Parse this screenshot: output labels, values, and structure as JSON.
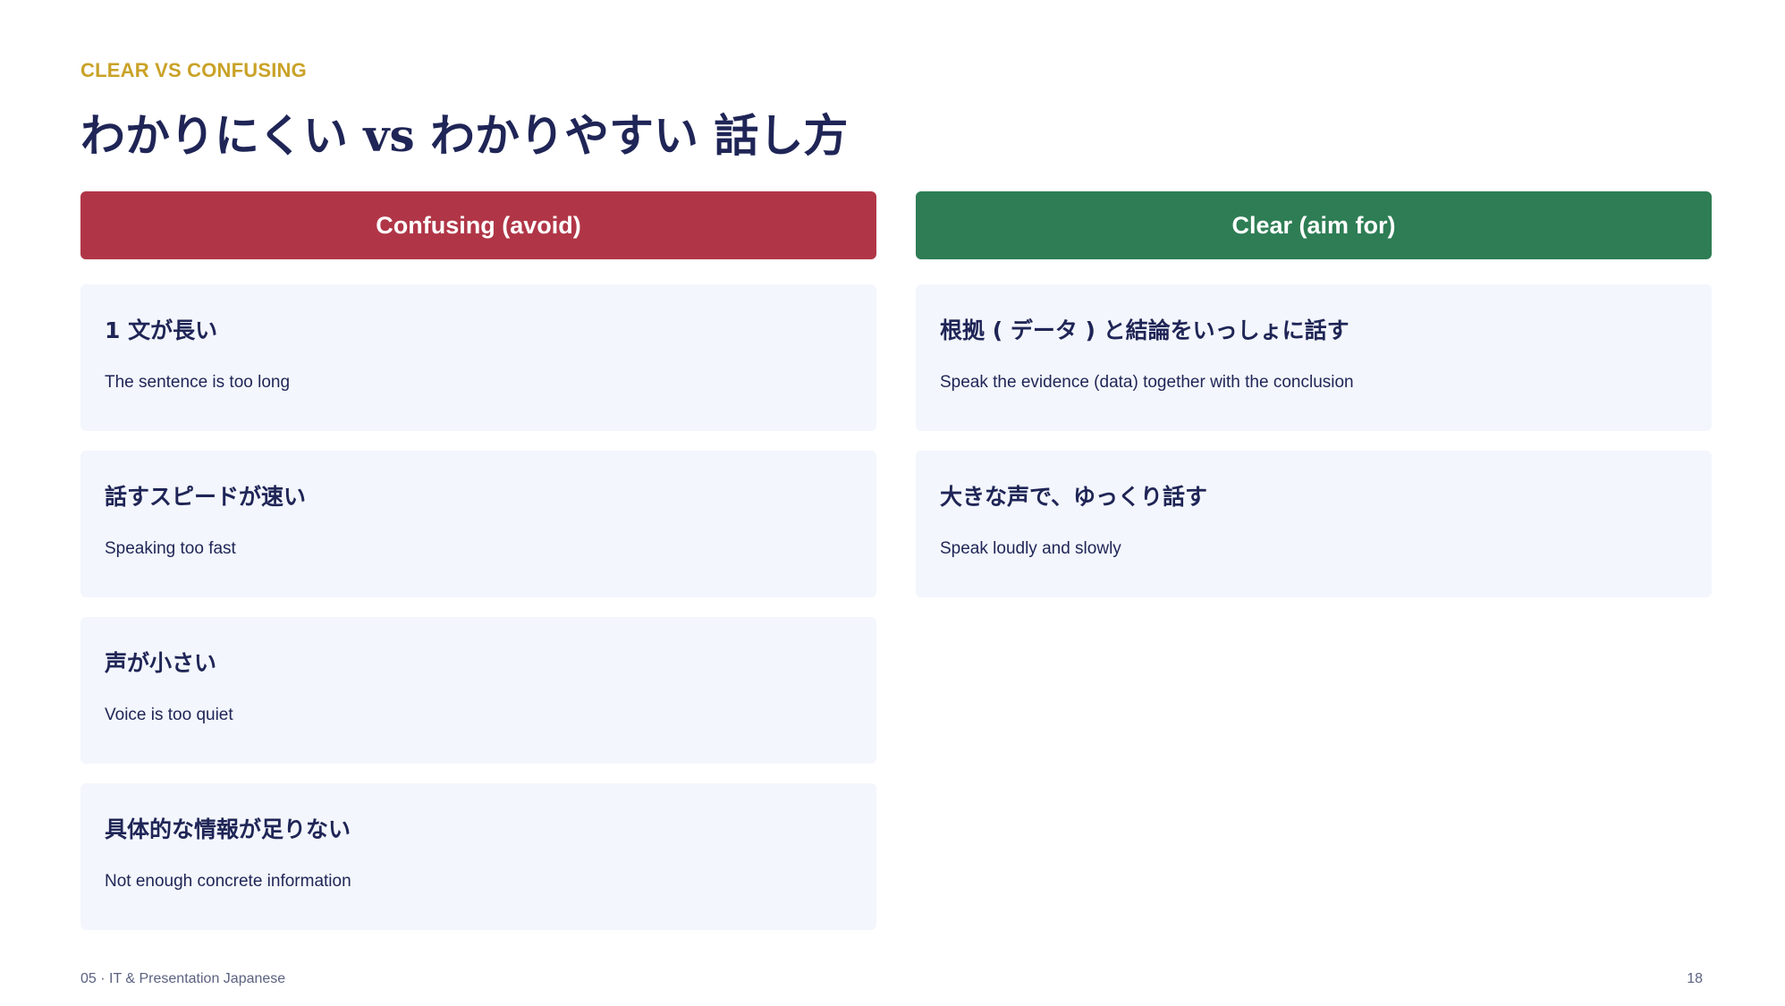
{
  "eyebrow": "CLEAR VS CONFUSING",
  "title": "わかりにくい vs わかりやすい 話し方",
  "colors": {
    "accent": "#c9a227",
    "confusing": "#b03647",
    "clear": "#2e7d54",
    "card_bg": "#f3f6fc",
    "text": "#1f2556"
  },
  "confusing": {
    "header": "Confusing (avoid)",
    "items": [
      {
        "jp": "1 文が長い",
        "en": "The sentence is too long"
      },
      {
        "jp": "話すスピードが速い",
        "en": "Speaking too fast"
      },
      {
        "jp": "声が小さい",
        "en": "Voice is too quiet"
      },
      {
        "jp": "具体的な情報が足りない",
        "en": "Not enough concrete information"
      }
    ]
  },
  "clear": {
    "header": "Clear (aim for)",
    "items": [
      {
        "jp": "根拠 ( データ ) と結論をいっしょに話す",
        "en": "Speak the evidence (data) together with the conclusion"
      },
      {
        "jp": "大きな声で、ゆっくり話す",
        "en": "Speak loudly and slowly"
      }
    ]
  },
  "footer": {
    "left": "05 · IT & Presentation Japanese",
    "page_number": "18"
  }
}
